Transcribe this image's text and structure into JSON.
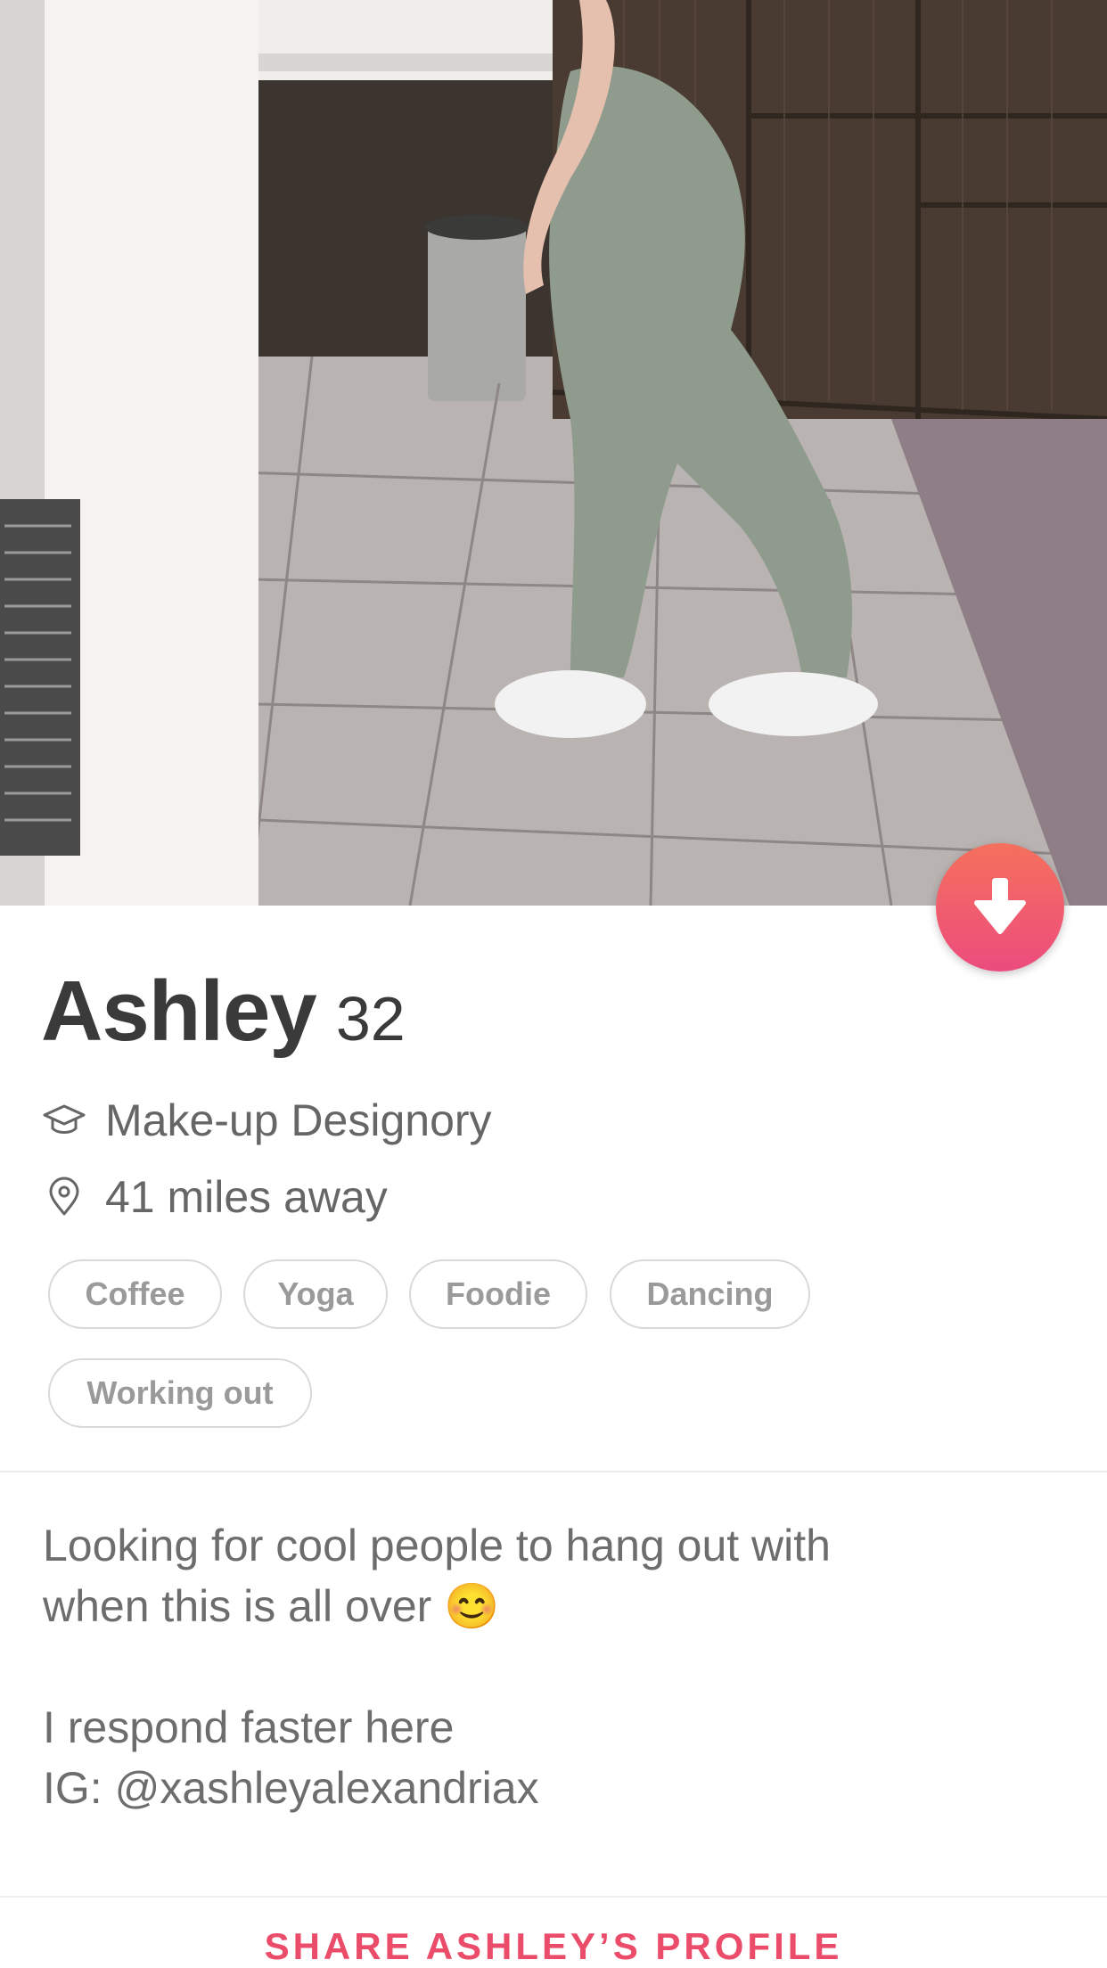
{
  "profile": {
    "name": "Ashley",
    "age": "32",
    "school": "Make-up Designory",
    "distance": "41 miles away"
  },
  "interests": [
    "Coffee",
    "Yoga",
    "Foodie",
    "Dancing",
    "Working out"
  ],
  "bio": {
    "line1": "Looking for cool people to hang out with",
    "line2": "when this is all over 😊",
    "line3": "I respond faster here",
    "line4": "IG: @xashleyalexandriax"
  },
  "actions": {
    "share_label": "SHARE ASHLEY’S PROFILE"
  },
  "icons": {
    "collapse": "arrow-down-icon",
    "school": "graduation-cap-icon",
    "distance": "location-pin-icon"
  },
  "colors": {
    "accent": "#ea4c6a",
    "button_gradient_top": "#f5705d",
    "button_gradient_bottom": "#ec4c7d"
  }
}
